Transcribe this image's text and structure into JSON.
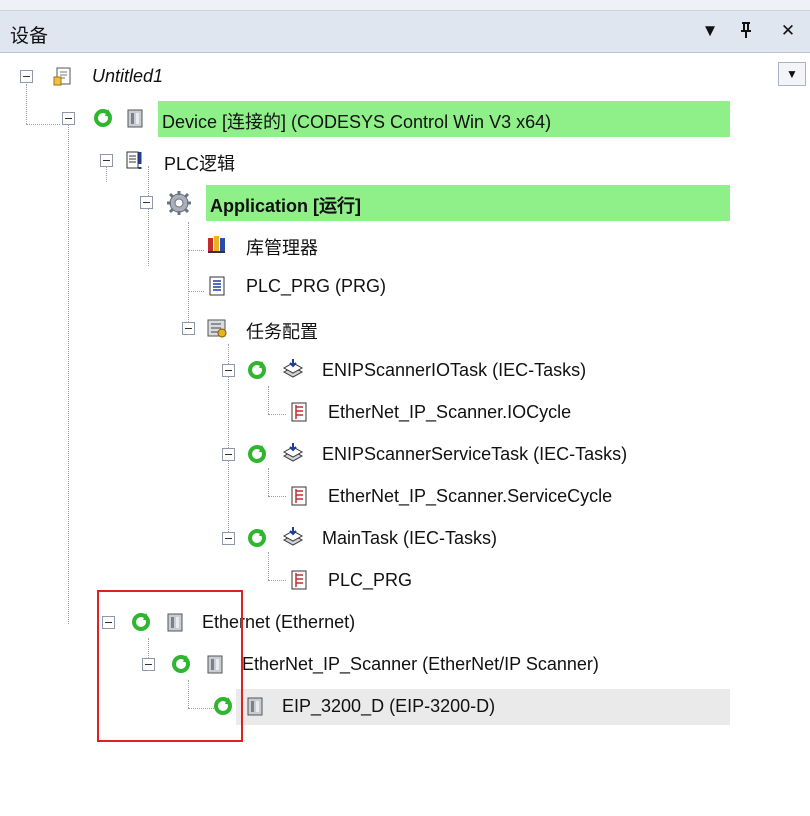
{
  "panel": {
    "title": "设备",
    "menu_glyph": "▼",
    "pin_glyph": "ᛝ",
    "close_glyph": "✕",
    "dropdown_glyph": "▼"
  },
  "colors": {
    "highlight": "#8ff08a",
    "selected": "#eaeaea",
    "header_bg": "#dfe6f0",
    "frame": "#e02020"
  },
  "tree": {
    "root": "Untitled1",
    "device": "Device [连接的] (CODESYS Control Win V3 x64)",
    "plc_logic": "PLC逻辑",
    "application": "Application [运行]",
    "library_manager": "库管理器",
    "plc_prg": "PLC_PRG (PRG)",
    "task_config": "任务配置",
    "tasks": [
      {
        "name": "ENIPScannerIOTask (IEC-Tasks)",
        "call": "EtherNet_IP_Scanner.IOCycle"
      },
      {
        "name": "ENIPScannerServiceTask (IEC-Tasks)",
        "call": "EtherNet_IP_Scanner.ServiceCycle"
      },
      {
        "name": "MainTask (IEC-Tasks)",
        "call": "PLC_PRG"
      }
    ],
    "ethernet": "Ethernet (Ethernet)",
    "scanner": "EtherNet_IP_Scanner (EtherNet/IP Scanner)",
    "adapter": "EIP_3200_D (EIP-3200-D)"
  }
}
